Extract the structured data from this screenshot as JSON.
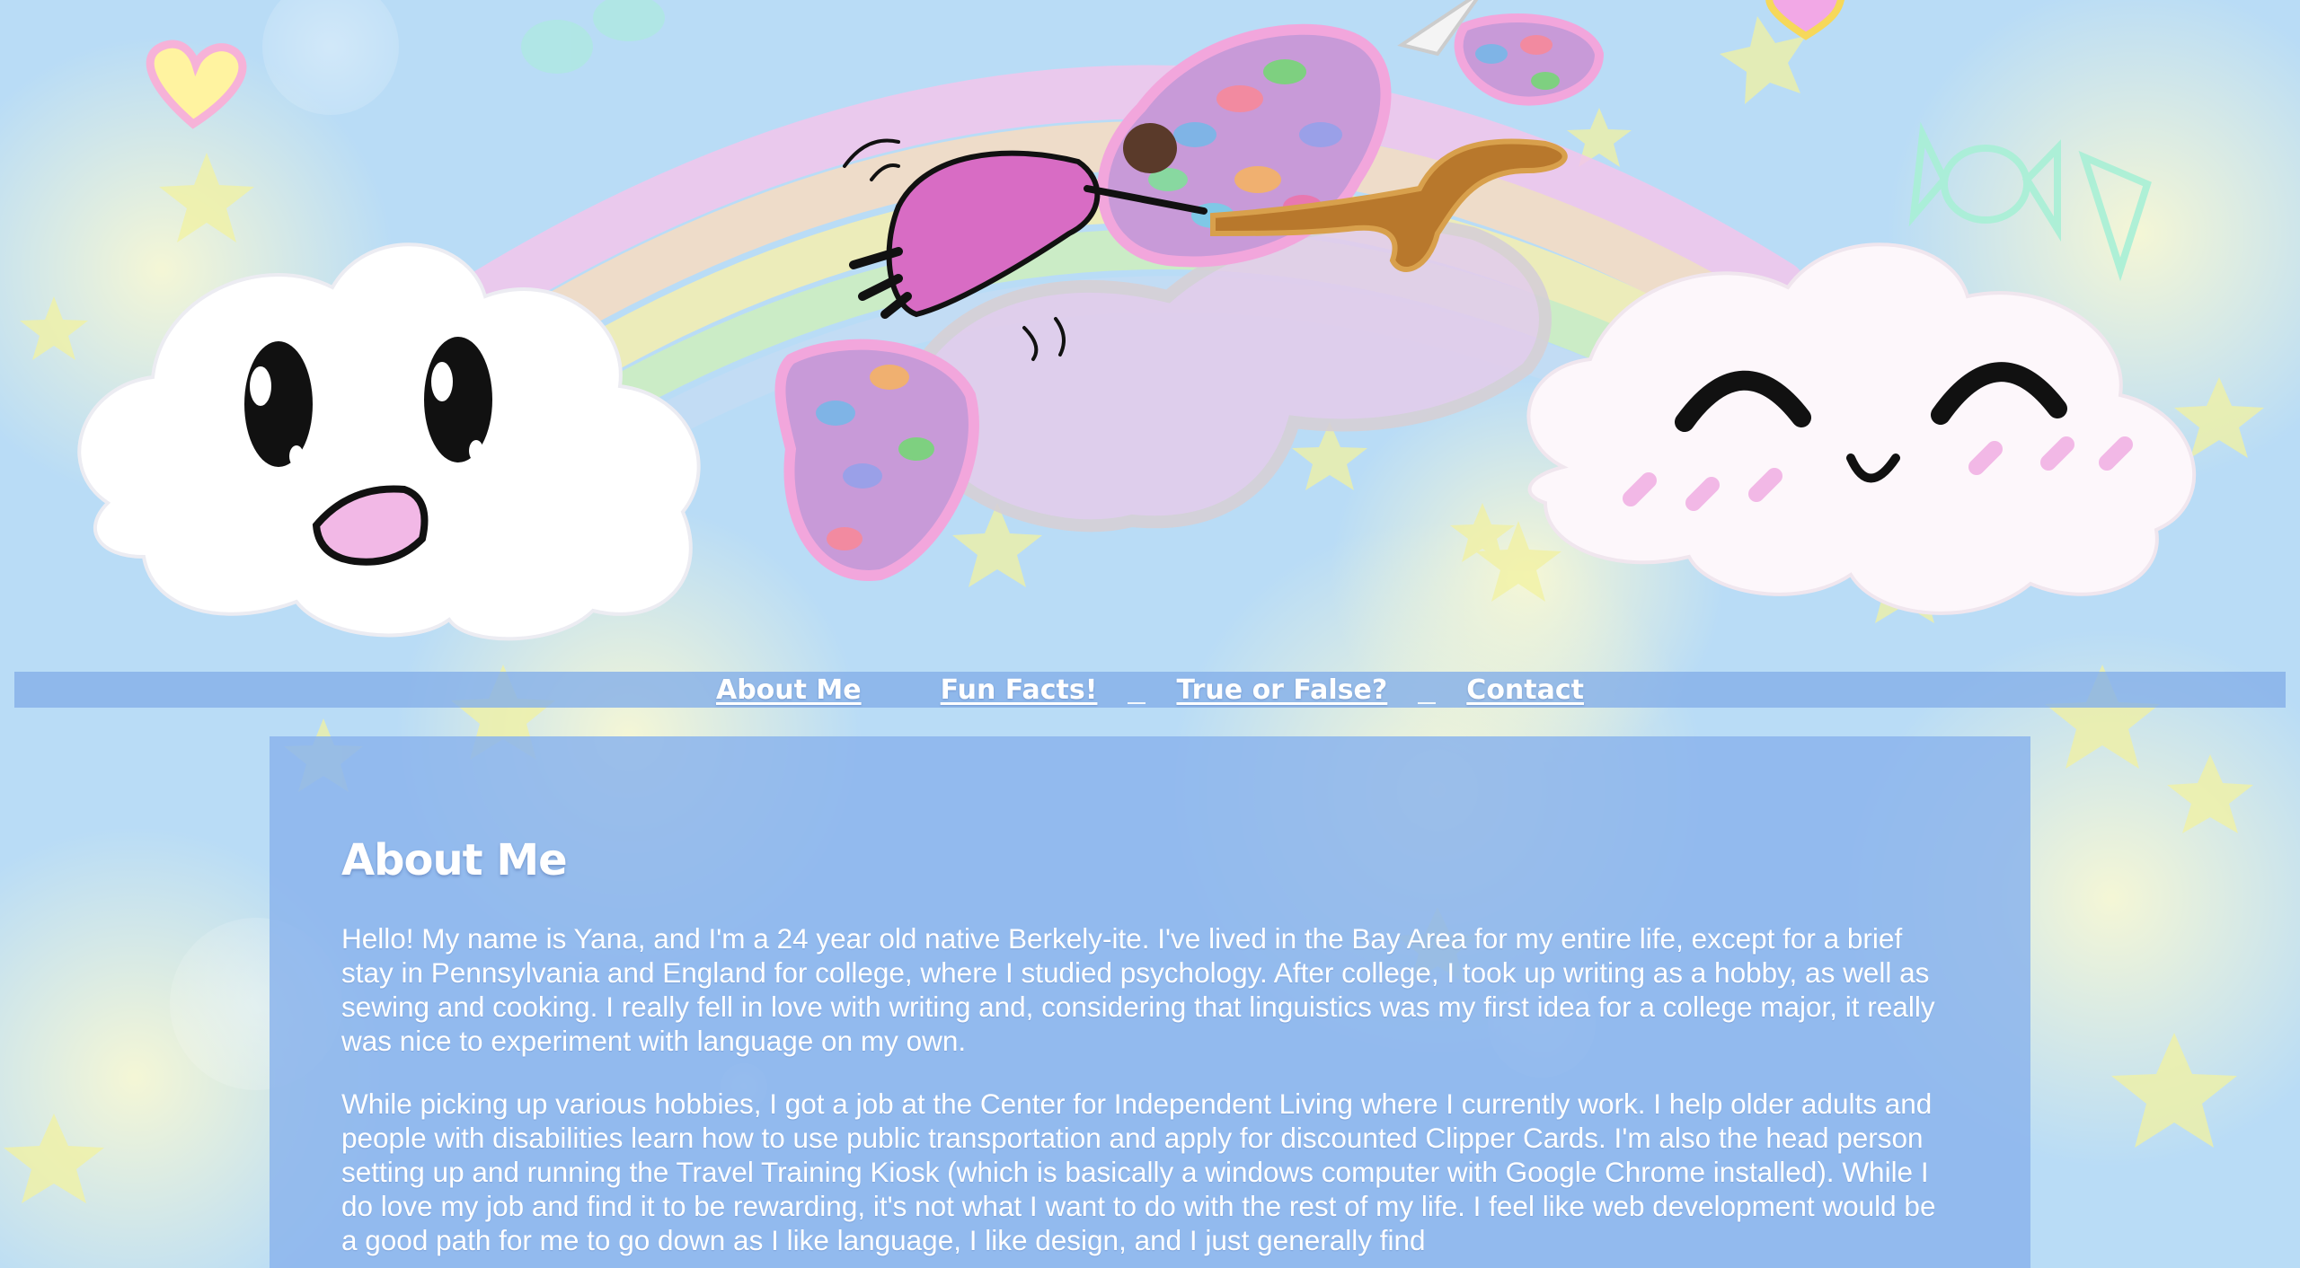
{
  "page": {
    "colors": {
      "sky": "#b9dcf6",
      "nav_bar": "#84afe8",
      "panel": "#8cb4ec",
      "text": "#ffffff"
    }
  },
  "banner": {
    "elements": [
      "cloud-surprised-icon",
      "cloud-happy-icon",
      "rainbow-icon",
      "flying-girl-unicorn-icon",
      "heart-icon",
      "candy-icon",
      "star-icon"
    ]
  },
  "nav": {
    "items": [
      {
        "label": "About Me"
      },
      {
        "label": "Fun Facts!"
      },
      {
        "label": "True or False?"
      },
      {
        "label": "Contact"
      }
    ]
  },
  "main": {
    "title": "About Me",
    "paragraphs": [
      "Hello! My name is Yana, and I'm a 24 year old native Berkely-ite. I've lived in the Bay Area for my entire life, except for a brief stay in Pennsylvania and England for college, where I studied psychology. After college, I took up writing as a hobby, as well as sewing and cooking. I really fell in love with writing and, considering that linguistics was my first idea for a college major, it really was nice to experiment with language on my own.",
      "While picking up various hobbies, I got a job at the Center for Independent Living where I currently work. I help older adults and people with disabilities learn how to use public transportation and apply for discounted Clipper Cards. I'm also the head person setting up and running the Travel Training Kiosk (which is basically a windows computer with Google Chrome installed). While I do love my job and find it to be rewarding, it's not what I want to do with the rest of my life. I feel like web development would be a good path for me to go down as I like language, I like design, and I just generally find"
    ]
  }
}
